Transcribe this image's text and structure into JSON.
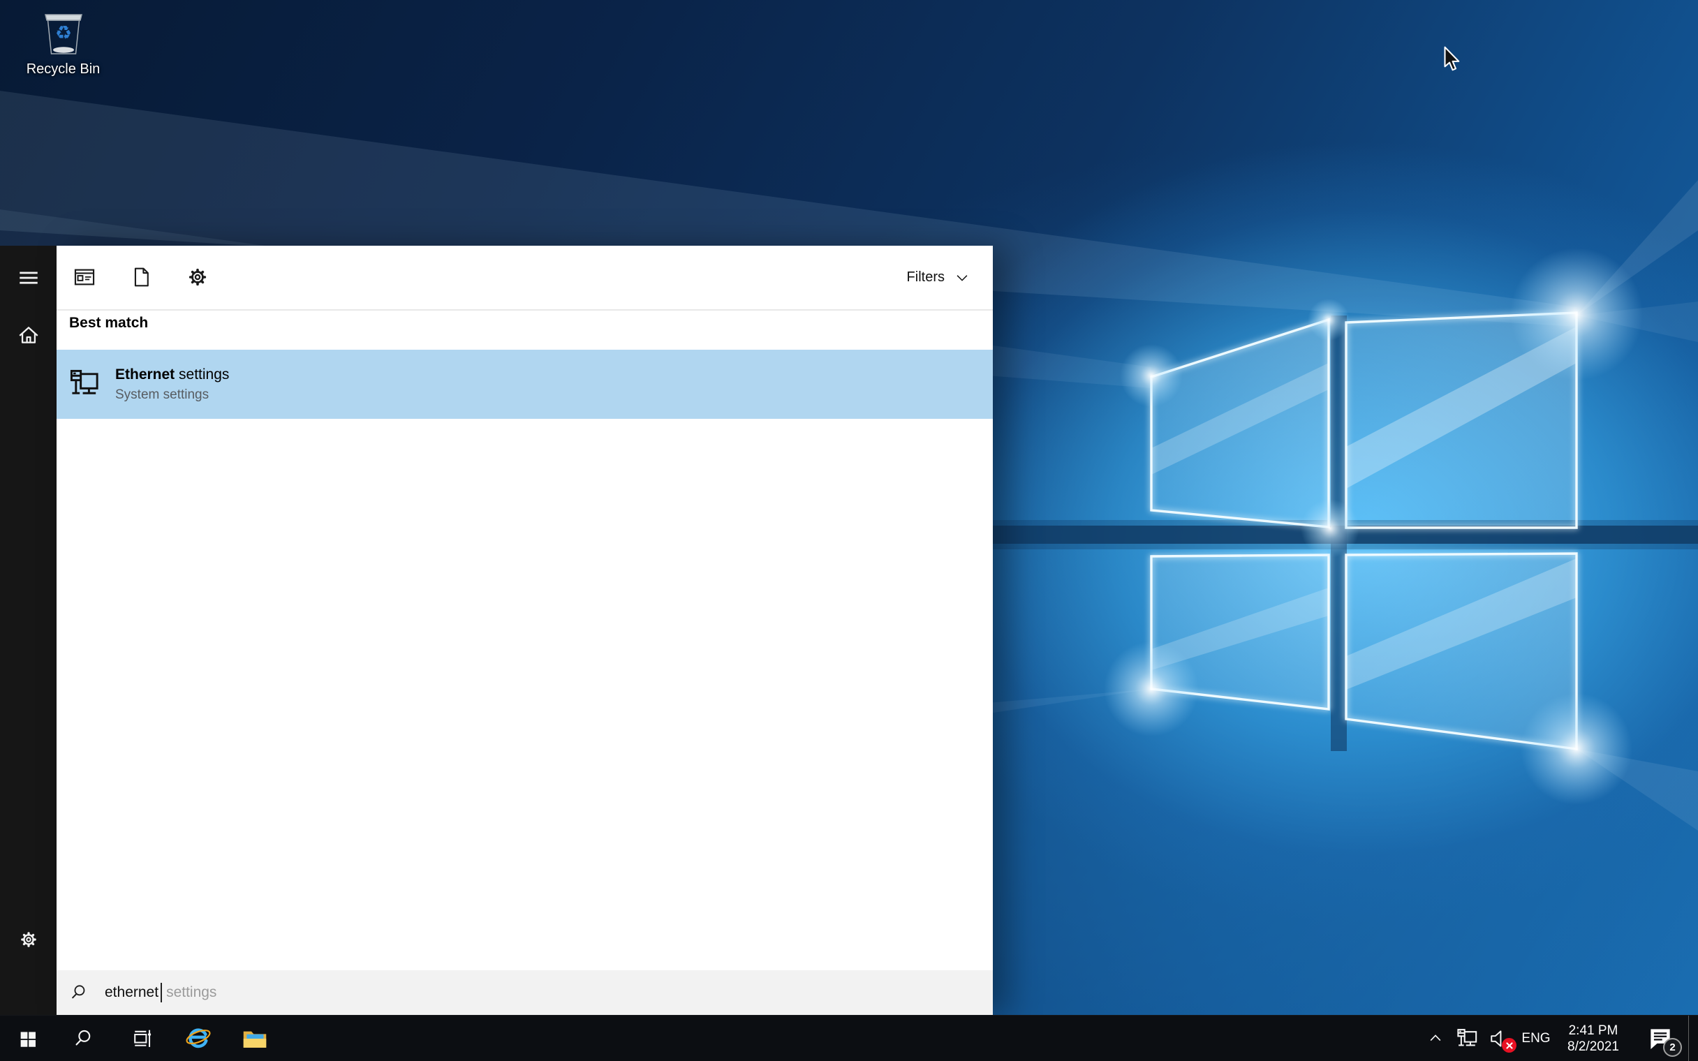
{
  "desktop": {
    "recycle_bin_label": "Recycle Bin"
  },
  "search_flyout": {
    "top_bar": {
      "filters_label": "Filters"
    },
    "section_header": "Best match",
    "result": {
      "title_bold": "Ethernet",
      "title_regular": " settings",
      "subtitle": "System settings"
    },
    "search_box": {
      "typed_text": "ethernet",
      "suggestion_text": "settings"
    }
  },
  "taskbar": {
    "tray": {
      "language_label": "ENG",
      "time": "2:41 PM",
      "date": "8/2/2021",
      "action_center_badge": "2"
    }
  },
  "icons": {
    "rail": [
      "hamburger-icon",
      "home-icon",
      "gear-icon"
    ],
    "top_bar": [
      "apps-icon",
      "document-icon",
      "gear-icon"
    ],
    "result_icon": "ethernet-monitor-icon",
    "search_box_icon": "search-icon",
    "taskbar_left": [
      "windows-start-icon",
      "search-icon",
      "task-view-icon",
      "internet-explorer-icon",
      "file-explorer-icon"
    ],
    "tray": [
      "chevron-up-icon",
      "ethernet-network-icon",
      "volume-muted-icon",
      "action-center-icon"
    ]
  },
  "colors": {
    "result_highlight": "#b0d6f0",
    "panel_bg": "#ffffff",
    "search_box_bg": "#f2f2f2",
    "rail_bg": "#161616",
    "taskbar_bg": "#0c0e12",
    "volume_error_badge": "#e81123",
    "wallpaper_accent": "#2e9fe6"
  }
}
